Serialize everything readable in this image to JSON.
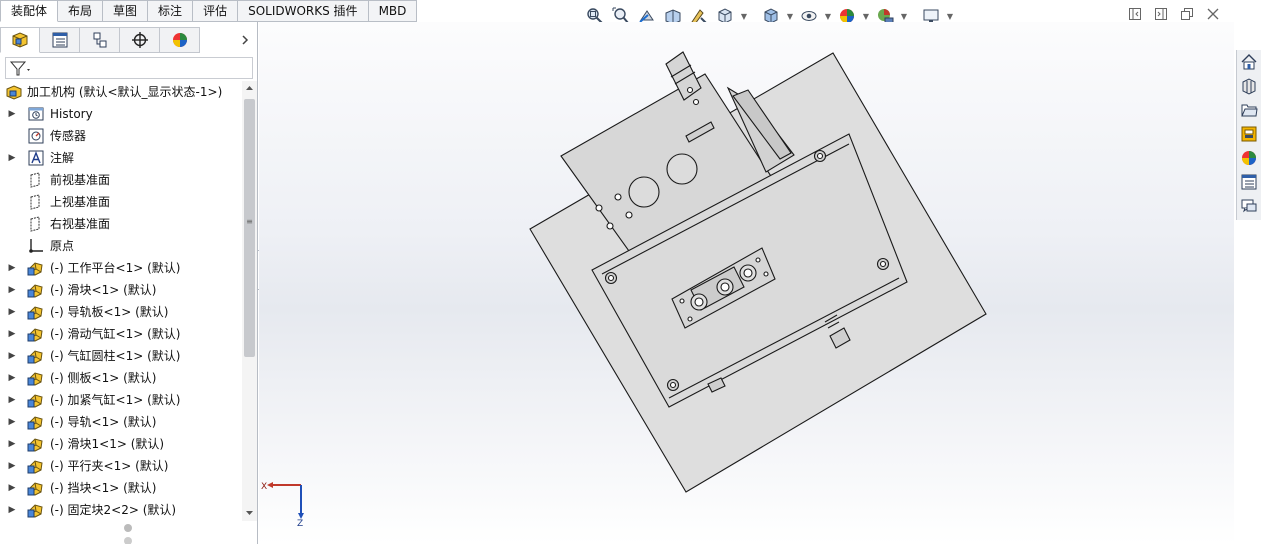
{
  "command_tabs": [
    {
      "label": "装配体",
      "active": true
    },
    {
      "label": "布局"
    },
    {
      "label": "草图"
    },
    {
      "label": "标注"
    },
    {
      "label": "评估"
    },
    {
      "label": "SOLIDWORKS 插件"
    },
    {
      "label": "MBD"
    }
  ],
  "heads_up_toolbar": {
    "icons": [
      "zoom-to-fit-icon",
      "zoom-to-area-icon",
      "previous-view-icon",
      "section-view-icon",
      "dynamic-annotation-icon",
      "view-orientation-icon",
      "display-style-icon",
      "hide-show-icon",
      "edit-appearance-icon",
      "apply-scene-icon",
      "view-settings-icon"
    ]
  },
  "window_controls": [
    "restore-left-icon",
    "restore-right-icon",
    "restore-window-icon",
    "close-icon"
  ],
  "feature_manager": {
    "panel_tabs": [
      "feature-manager-tab-icon",
      "property-manager-tab-icon",
      "configuration-manager-tab-icon",
      "dimxpert-manager-tab-icon",
      "display-manager-tab-icon"
    ],
    "filter_icon": "filter-icon",
    "root": {
      "label": "加工机构  (默认<默认_显示状态-1>)",
      "icon": "assembly-icon"
    },
    "items": [
      {
        "label": "History",
        "icon": "history-icon",
        "expandable": true
      },
      {
        "label": "传感器",
        "icon": "sensor-icon",
        "expandable": false
      },
      {
        "label": "注解",
        "icon": "annotation-icon",
        "expandable": true
      },
      {
        "label": "前视基准面",
        "icon": "plane-icon",
        "expandable": false
      },
      {
        "label": "上视基准面",
        "icon": "plane-icon",
        "expandable": false
      },
      {
        "label": "右视基准面",
        "icon": "plane-icon",
        "expandable": false
      },
      {
        "label": "原点",
        "icon": "origin-icon",
        "expandable": false
      },
      {
        "label": "(-) 工作平台<1> (默认)",
        "icon": "part-icon",
        "expandable": true
      },
      {
        "label": "(-) 滑块<1> (默认)",
        "icon": "part-icon",
        "expandable": true
      },
      {
        "label": "(-) 导轨板<1> (默认)",
        "icon": "part-icon",
        "expandable": true
      },
      {
        "label": "(-) 滑动气缸<1> (默认)",
        "icon": "part-icon",
        "expandable": true
      },
      {
        "label": "(-) 气缸圆柱<1> (默认)",
        "icon": "part-icon",
        "expandable": true
      },
      {
        "label": "(-) 侧板<1> (默认)",
        "icon": "part-icon",
        "expandable": true
      },
      {
        "label": "(-) 加紧气缸<1> (默认)",
        "icon": "part-icon",
        "expandable": true
      },
      {
        "label": "(-) 导轨<1> (默认)",
        "icon": "part-icon",
        "expandable": true
      },
      {
        "label": "(-) 滑块1<1> (默认)",
        "icon": "part-icon",
        "expandable": true
      },
      {
        "label": "(-) 平行夹<1> (默认)",
        "icon": "part-icon",
        "expandable": true
      },
      {
        "label": "(-) 挡块<1> (默认)",
        "icon": "part-icon",
        "expandable": true
      },
      {
        "label": "(-) 固定块2<2> (默认)",
        "icon": "part-icon",
        "expandable": true
      }
    ]
  },
  "triad": {
    "x_label": "X",
    "z_label": "Z"
  },
  "task_pane": [
    "home-icon",
    "design-library-icon",
    "file-explorer-icon",
    "view-palette-icon",
    "appearances-icon",
    "custom-properties-icon",
    "forum-icon"
  ]
}
